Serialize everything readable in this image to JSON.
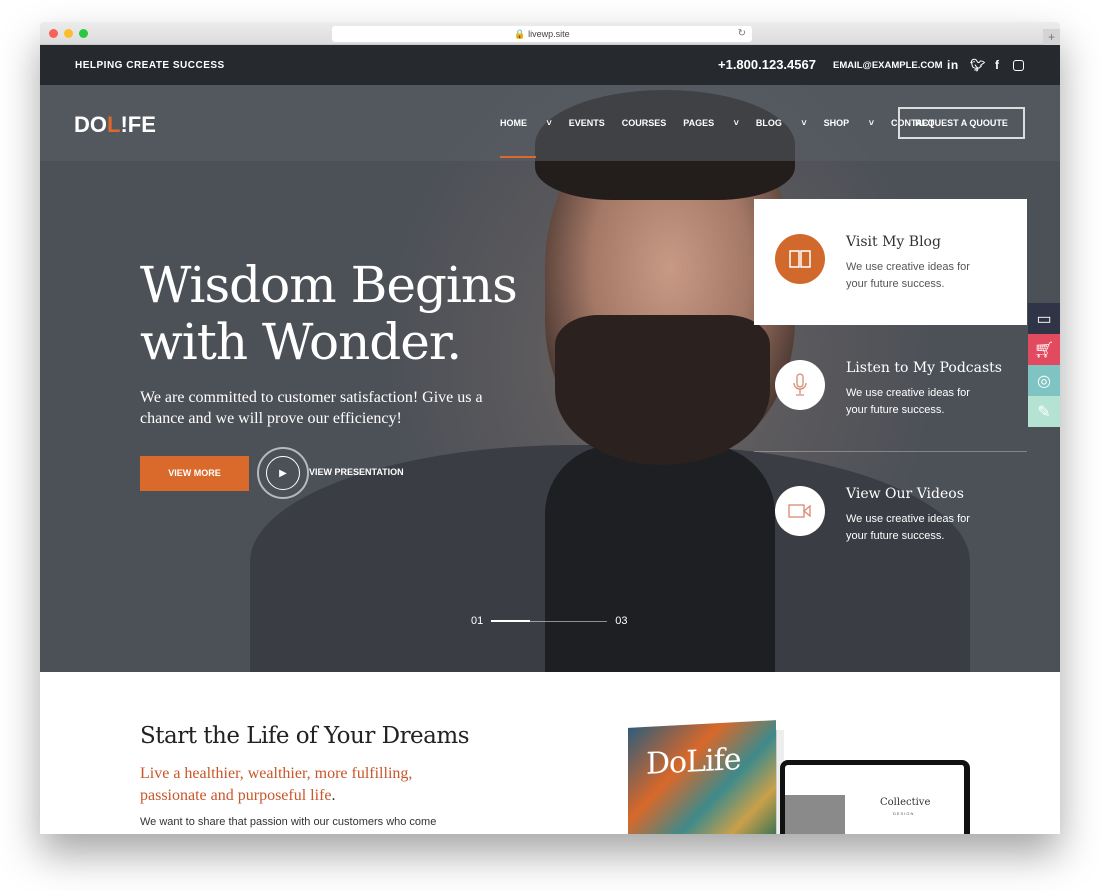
{
  "browser": {
    "url": "livewp.site"
  },
  "topbar": {
    "tagline": "HELPING CREATE SUCCESS",
    "phone": "+1.800.123.4567",
    "email": "EMAIL@EXAMPLE.COM",
    "social": [
      "linkedin-icon",
      "twitter-icon",
      "facebook-icon",
      "instagram-icon"
    ]
  },
  "nav": {
    "logo": "DOLIFE",
    "items": [
      {
        "label": "HOME",
        "dropdown": true,
        "active": true
      },
      {
        "label": "EVENTS"
      },
      {
        "label": "COURSES"
      },
      {
        "label": "PAGES",
        "dropdown": true
      },
      {
        "label": "BLOG",
        "dropdown": true
      },
      {
        "label": "SHOP",
        "dropdown": true
      },
      {
        "label": "CONTACT"
      }
    ],
    "cta": "REQUEST A QUOUTE"
  },
  "hero": {
    "title_line1": "Wisdom Begins",
    "title_line2": "with Wonder.",
    "subtitle": "We are committed to customer satisfaction! Give us a chance and we will prove our efficiency!",
    "primary_button": "VIEW MORE",
    "secondary_button": "VIEW PRESENTATION",
    "slider": {
      "current": "01",
      "total": "03",
      "progress": 0.33
    }
  },
  "features": [
    {
      "title": "Visit My Blog",
      "desc": "We use creative ideas for your future success.",
      "icon": "book-icon"
    },
    {
      "title": "Listen to My Podcasts",
      "desc": "We use creative ideas for your future success.",
      "icon": "microphone-icon"
    },
    {
      "title": "View Our Videos",
      "desc": "We use creative ideas for your future success.",
      "icon": "video-camera-icon"
    }
  ],
  "side_tools": [
    {
      "icon": "monitor-icon",
      "color": "#2f3547"
    },
    {
      "icon": "cart-icon",
      "color": "#e24a5f"
    },
    {
      "icon": "lifebuoy-icon",
      "color": "#7fc3c3"
    },
    {
      "icon": "edit-icon",
      "color": "#b4e3d3"
    }
  ],
  "colors": {
    "accent": "#d96a2b",
    "topbar": "#262a2f"
  },
  "section": {
    "title": "Start the Life of Your Dreams",
    "lead": "Live a healthier, wealthier, more fulfilling, passionate and purposeful life",
    "lead_end": ".",
    "body": "We want to share that passion with our customers who come",
    "book_title": "DoLife",
    "laptop_title": "Collective",
    "laptop_sub": "DESIGN"
  }
}
